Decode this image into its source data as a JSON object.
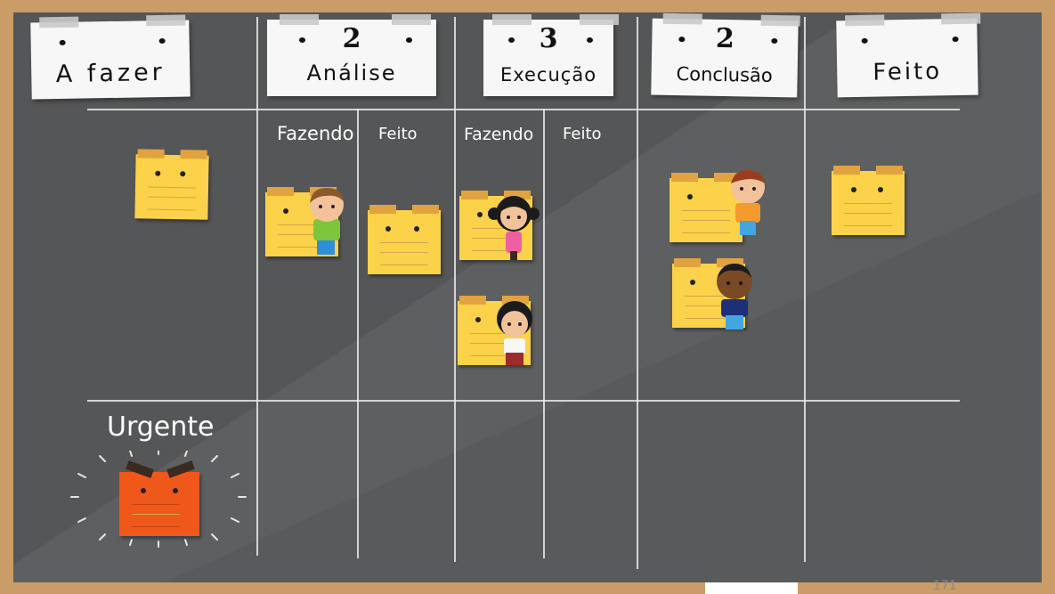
{
  "columns": [
    {
      "title": "A fazer",
      "wip": ""
    },
    {
      "title": "Análise",
      "wip": "2"
    },
    {
      "title": "Execução",
      "wip": "3"
    },
    {
      "title": "Conclusão",
      "wip": "2"
    },
    {
      "title": "Feito",
      "wip": ""
    }
  ],
  "subcolumns": {
    "analise_doing": "Fazendo",
    "analise_done": "Feito",
    "execucao_doing": "Fazendo",
    "execucao_done": "Feito"
  },
  "swimlane": {
    "urgent_label": "Urgente"
  },
  "page_number": "171",
  "colors": {
    "board": "#555657",
    "frame": "#c99c68",
    "note": "#fbd24a",
    "urgent_note": "#f0571a"
  }
}
